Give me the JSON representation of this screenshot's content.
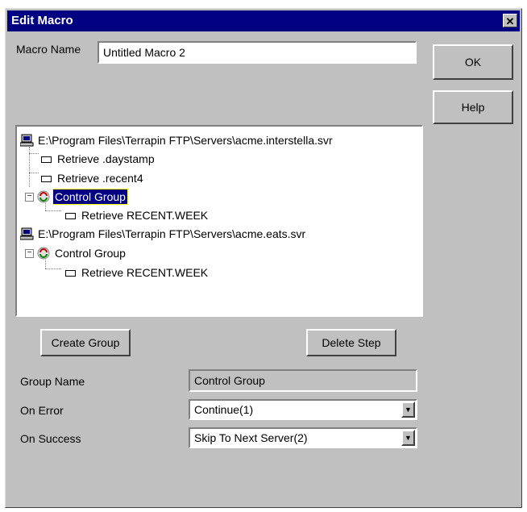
{
  "dialog": {
    "title": "Edit Macro",
    "close_glyph": "✕"
  },
  "macro_name": {
    "label": "Macro Name",
    "value": "Untitled Macro 2"
  },
  "buttons": {
    "ok": "OK",
    "help": "Help",
    "create_group": "Create Group",
    "delete_step": "Delete Step"
  },
  "tree": {
    "server1": "E:\\Program Files\\Terrapin FTP\\Servers\\acme.interstella.svr",
    "s1_item1": "Retrieve .daystamp",
    "s1_item2": "Retrieve .recent4",
    "s1_group": "Control Group",
    "s1_group_item": "Retrieve RECENT.WEEK",
    "server2": "E:\\Program Files\\Terrapin FTP\\Servers\\acme.eats.svr",
    "s2_group": "Control Group",
    "s2_group_item": "Retrieve RECENT.WEEK"
  },
  "group_name": {
    "label": "Group Name",
    "value": "Control Group"
  },
  "on_error": {
    "label": "On Error",
    "value": "Continue(1)"
  },
  "on_success": {
    "label": "On Success",
    "value": "Skip To Next Server(2)"
  },
  "icons": {
    "server": "computer-icon",
    "group": "group-cycle-icon",
    "step": "step-doc-icon"
  }
}
